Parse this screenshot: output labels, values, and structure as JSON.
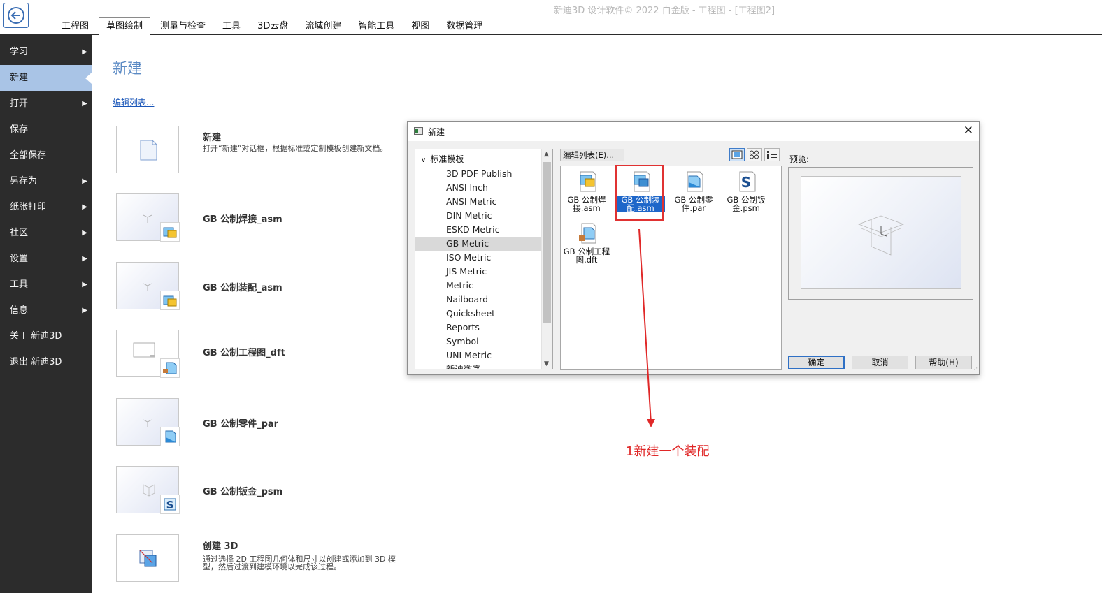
{
  "window": {
    "title": "新迪3D 设计软件© 2022 白金版 - 工程图 - [工程图2]"
  },
  "ribbon": {
    "tabs": [
      {
        "label": "工程图",
        "active": false
      },
      {
        "label": "草图绘制",
        "active": true
      },
      {
        "label": "测量与检查",
        "active": false
      },
      {
        "label": "工具",
        "active": false
      },
      {
        "label": "3D云盘",
        "active": false
      },
      {
        "label": "流域创建",
        "active": false
      },
      {
        "label": "智能工具",
        "active": false
      },
      {
        "label": "视图",
        "active": false
      },
      {
        "label": "数据管理",
        "active": false
      }
    ]
  },
  "sidebar": {
    "items": [
      {
        "label": "学习",
        "arrow": "▶"
      },
      {
        "label": "新建",
        "arrow": ""
      },
      {
        "label": "打开",
        "arrow": "▶"
      },
      {
        "label": "保存",
        "arrow": ""
      },
      {
        "label": "全部保存",
        "arrow": ""
      },
      {
        "label": "另存为",
        "arrow": "▶"
      },
      {
        "label": "纸张打印",
        "arrow": "▶"
      },
      {
        "label": "社区",
        "arrow": "▶"
      },
      {
        "label": "设置",
        "arrow": "▶"
      },
      {
        "label": "工具",
        "arrow": "▶"
      },
      {
        "label": "信息",
        "arrow": "▶"
      },
      {
        "label": "关于 新迪3D",
        "arrow": ""
      },
      {
        "label": "退出 新迪3D",
        "arrow": ""
      }
    ]
  },
  "main": {
    "title": "新建",
    "edit_list": "编辑列表...",
    "entries": [
      {
        "title": "新建",
        "desc": "打开“新建”对话框，根据标准或定制模板创建新文档。"
      },
      {
        "title": "GB 公制焊接_asm",
        "desc": ""
      },
      {
        "title": "GB 公制装配_asm",
        "desc": ""
      },
      {
        "title": "GB 公制工程图_dft",
        "desc": ""
      },
      {
        "title": "GB 公制零件_par",
        "desc": ""
      },
      {
        "title": "GB 公制钣金_psm",
        "desc": ""
      },
      {
        "title": "创建 3D",
        "desc": "通过选择 2D 工程图几何体和尺寸以创建或添加到 3D 模型，然后过渡到建模环境以完成该过程。"
      }
    ]
  },
  "dialog": {
    "title": "新建",
    "close": "✕",
    "tree": {
      "root": "标准模板",
      "items": [
        "3D PDF Publish",
        "ANSI Inch",
        "ANSI Metric",
        "DIN Metric",
        "ESKD Metric",
        "GB Metric",
        "ISO Metric",
        "JIS Metric",
        "Metric",
        "Nailboard",
        "Quicksheet",
        "Reports",
        "Symbol",
        "UNI Metric",
        "新迪数字"
      ],
      "selected": "GB Metric"
    },
    "edit_list_button": "编辑列表(E)...",
    "files": [
      {
        "line1": "GB 公制焊",
        "line2": "接.asm",
        "icon": "weld-assembly-icon"
      },
      {
        "line1": "GB 公制装",
        "line2": "配.asm",
        "icon": "assembly-icon"
      },
      {
        "line1": "GB 公制零",
        "line2": "件.par",
        "icon": "part-icon"
      },
      {
        "line1": "GB 公制钣",
        "line2": "金.psm",
        "icon": "sheet-metal-icon"
      },
      {
        "line1": "GB 公制工程",
        "line2": "图.dft",
        "icon": "drawing-icon"
      }
    ],
    "preview_label": "预览:",
    "buttons": {
      "ok": "确定",
      "cancel": "取消",
      "help": "帮助(H)"
    }
  },
  "annotation": {
    "text": "1新建一个装配",
    "color": "#e02828"
  }
}
